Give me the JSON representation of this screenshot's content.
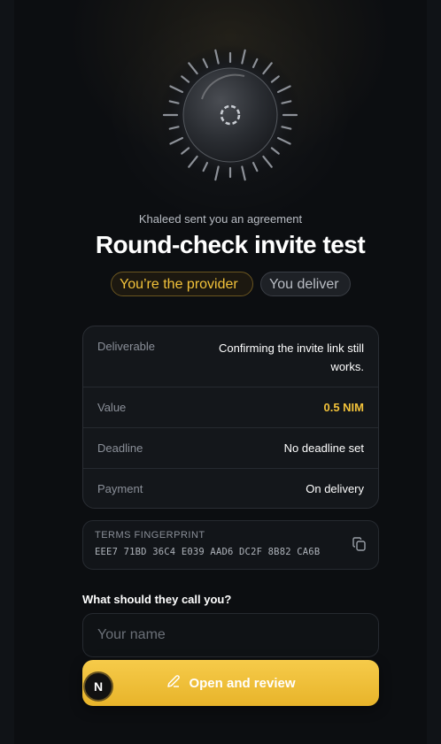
{
  "header": {
    "sent_text": "Khaleed sent you an agreement",
    "title": "Round-check invite test"
  },
  "roles": {
    "provider": "You’re the provider",
    "deliver": "You deliver"
  },
  "details": [
    {
      "label": "Deliverable",
      "value": "Confirming the invite link still works."
    },
    {
      "label": "Value",
      "value": "0.5 NIM"
    },
    {
      "label": "Deadline",
      "value": "No deadline set"
    },
    {
      "label": "Payment",
      "value": "On delivery"
    }
  ],
  "fingerprint": {
    "label": "TERMS FINGERPRINT",
    "code": "EEE7 71BD 36C4 E039 AAD6 DC2F 8B82 CA6B"
  },
  "name_field": {
    "label": "What should they call you?",
    "placeholder": "Your name",
    "value": ""
  },
  "cta": {
    "label": "Open and review"
  },
  "badge": {
    "letter": "N"
  },
  "colors": {
    "accent": "#f2c23a",
    "background": "#0c0e11"
  }
}
